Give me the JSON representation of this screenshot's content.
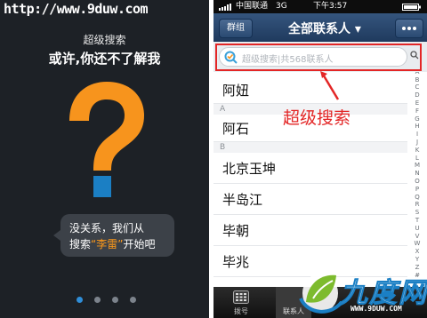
{
  "watermark": {
    "url": "http://www.9duw.com"
  },
  "intro_screen": {
    "subtitle": "超级搜索",
    "headline": "或许,你还不了解我",
    "bubble": {
      "line1": "没关系，我们从",
      "line2_prefix": "搜索",
      "line2_highlight": "“李雷”",
      "line2_suffix": "开始吧"
    },
    "page_indicator": {
      "total": 4,
      "active": 0
    }
  },
  "contacts_screen": {
    "status_bar": {
      "carrier": "中国联通",
      "network": "3G",
      "time": "下午3:57"
    },
    "nav": {
      "left_button": "群组",
      "title": "全部联系人 ▾",
      "right_button_icon": "more-dots-icon"
    },
    "search": {
      "placeholder": "超级搜索|共568联系人"
    },
    "index_letters": [
      "Q",
      "A",
      "B",
      "C",
      "D",
      "E",
      "F",
      "G",
      "H",
      "I",
      "J",
      "K",
      "L",
      "M",
      "N",
      "O",
      "P",
      "Q",
      "R",
      "S",
      "T",
      "U",
      "V",
      "W",
      "X",
      "Y",
      "Z",
      "#"
    ],
    "sections": [
      {
        "header": "",
        "contacts": [
          "阿妞"
        ]
      },
      {
        "header": "A",
        "contacts": [
          "阿石"
        ]
      },
      {
        "header": "B",
        "contacts": [
          "北京玉坤",
          "半岛江",
          "毕朝",
          "毕兆"
        ]
      }
    ],
    "tabs": [
      {
        "label": "拨号",
        "icon": "dialpad-icon"
      },
      {
        "label": "联系人",
        "icon": "contacts-icon"
      }
    ]
  },
  "annotation": {
    "label": "超级搜索",
    "color": "#e32626"
  },
  "brand": {
    "name": "九度网",
    "url": "WWW.9DUW.COM"
  },
  "colors": {
    "accent_orange": "#f7941d",
    "accent_blue": "#1b7fc4",
    "nav_blue": "#2a4a72",
    "highlight_red": "#e32626"
  }
}
